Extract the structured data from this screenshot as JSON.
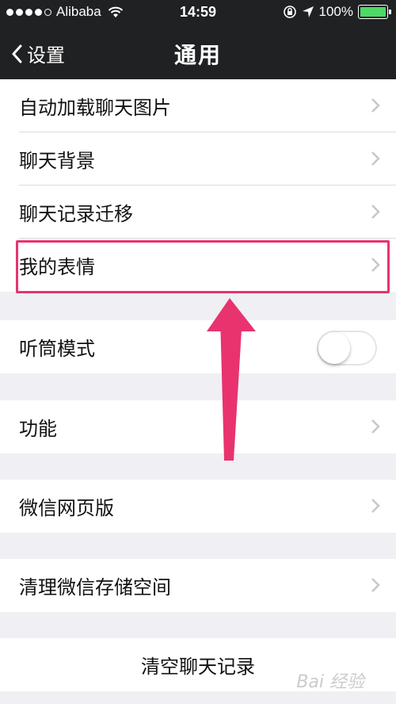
{
  "status_bar": {
    "carrier": "Alibaba",
    "time": "14:59",
    "battery": "100%",
    "signal_dots": 5,
    "signal_filled": 4
  },
  "nav": {
    "back_label": "设置",
    "title": "通用"
  },
  "group1": [
    {
      "label": "自动加载聊天图片"
    },
    {
      "label": "聊天背景"
    },
    {
      "label": "聊天记录迁移"
    },
    {
      "label": "我的表情"
    }
  ],
  "group2": {
    "label": "听筒模式",
    "toggle_on": false
  },
  "group3": {
    "label": "功能"
  },
  "group4": {
    "label": "微信网页版"
  },
  "group5": {
    "label": "清理微信存储空间"
  },
  "group6": {
    "label": "清空聊天记录"
  },
  "annotation": {
    "highlight_color": "#e8336f"
  },
  "watermark": "Bai 经验"
}
